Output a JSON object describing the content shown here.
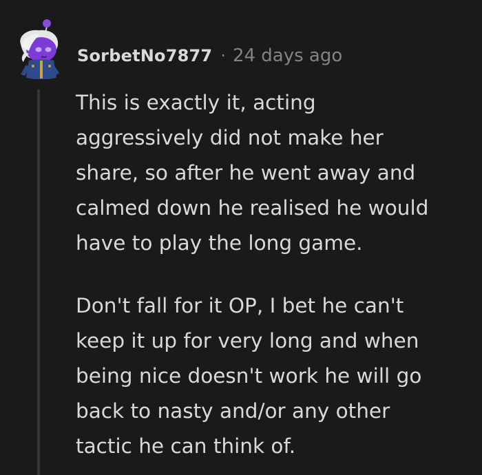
{
  "comment": {
    "author": "SorbetNo7877",
    "separator": "·",
    "timestamp": "24 days ago",
    "paragraphs": [
      [
        "This is exactly it, acting",
        "aggressively did not make her",
        "share, so after he went away and",
        "calmed down he realised he would",
        "have to play the long game."
      ],
      [
        "Don't fall for it OP, I bet he can't",
        "keep it up for very long and when",
        "being nice doesn't work he will go",
        "back to nasty and/or any other",
        "tactic he can think of."
      ]
    ],
    "avatar_icon": "snoo-avatar-icon"
  },
  "colors": {
    "background": "#1a1a1b",
    "text": "#d7dadc",
    "meta": "#818384",
    "thread_line": "#343536",
    "avatar_face": "#7a3bd6",
    "avatar_eyes": "#c8a8ff",
    "avatar_hair": "#e4e6e8",
    "avatar_outfit": "#2e4a8c"
  }
}
